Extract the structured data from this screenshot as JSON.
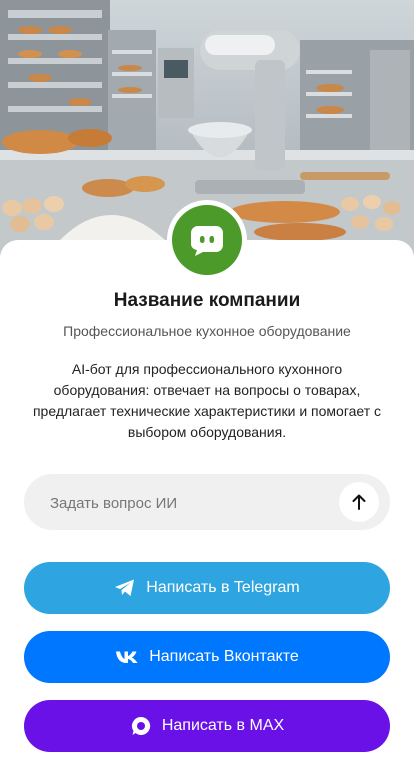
{
  "company": {
    "name": "Название компании",
    "subtitle": "Профессиональное кухонное оборудование",
    "description": "AI-бот для профессионального кухонного оборудования: отвечает на вопросы о товарах, предлагает технические характеристики и помогает с выбором оборудования."
  },
  "ask": {
    "placeholder": "Задать вопрос ИИ"
  },
  "buttons": {
    "telegram": "Написать в Telegram",
    "vk": "Написать Вконтакте",
    "max": "Написать в MAX"
  },
  "colors": {
    "avatar": "#4c9a2a",
    "telegram": "#2ea5e0",
    "vk": "#0077ff",
    "max": "#6a11e8"
  },
  "icons": {
    "avatar": "chat-bot-icon",
    "send": "arrow-up-icon",
    "telegram": "telegram-icon",
    "vk": "vk-icon",
    "max": "max-icon"
  }
}
